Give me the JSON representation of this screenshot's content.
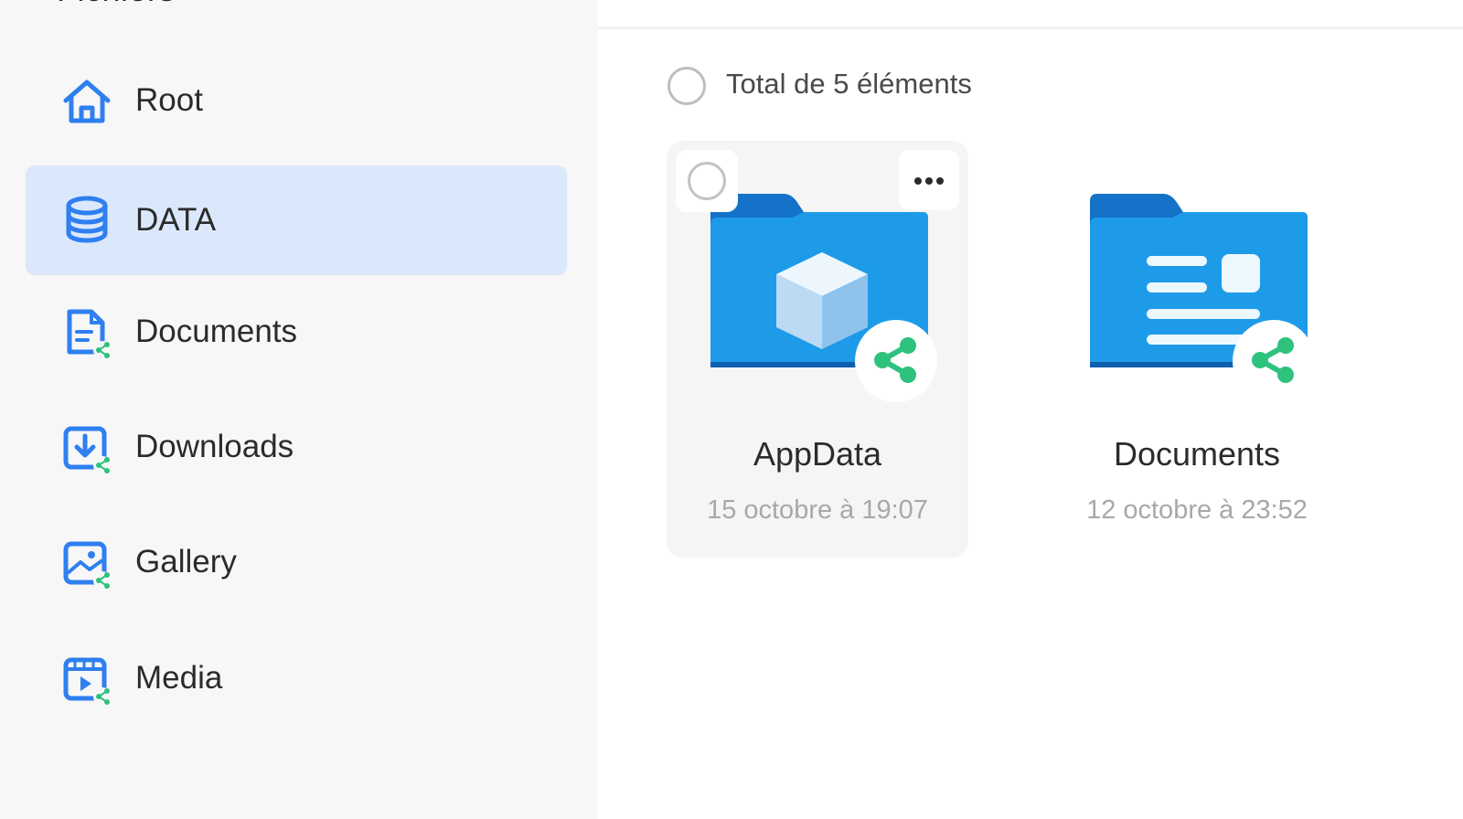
{
  "sidebar": {
    "title": "Fichiers",
    "items": [
      {
        "label": "Root",
        "icon": "home-icon"
      },
      {
        "label": "DATA",
        "icon": "database-icon",
        "active": true
      },
      {
        "label": "Documents",
        "icon": "document-shared-icon"
      },
      {
        "label": "Downloads",
        "icon": "download-shared-icon"
      },
      {
        "label": "Gallery",
        "icon": "gallery-shared-icon"
      },
      {
        "label": "Media",
        "icon": "media-shared-icon"
      }
    ]
  },
  "main": {
    "total_label": "Total de 5 éléments",
    "folders": [
      {
        "name": "AppData",
        "date": "15 octobre à 19:07",
        "icon": "folder-appdata-icon",
        "shared": true
      },
      {
        "name": "Documents",
        "date": "12 octobre à 23:52",
        "icon": "folder-documents-icon",
        "shared": true
      }
    ]
  },
  "colors": {
    "accent": "#2f7ff0",
    "active_bg": "#dbe8fc",
    "share_green": "#2ec27e",
    "folder_back": "#1473c9",
    "folder_front": "#1e9be8"
  }
}
